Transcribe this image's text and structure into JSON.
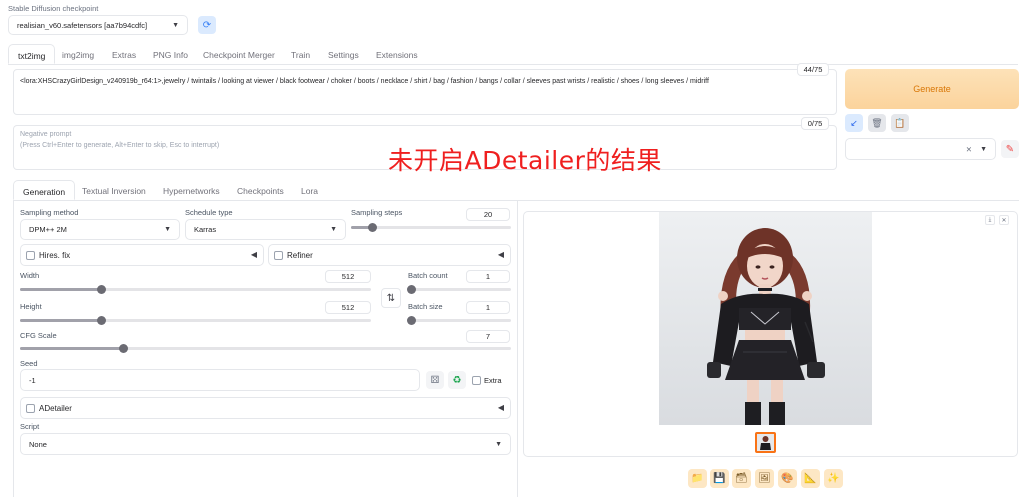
{
  "checkpoint": {
    "label": "Stable Diffusion checkpoint",
    "value": "realisian_v60.safetensors [aa7b94cdfc]"
  },
  "main_tabs": [
    "txt2img",
    "img2img",
    "Extras",
    "PNG Info",
    "Checkpoint Merger",
    "Train",
    "Settings",
    "Extensions"
  ],
  "prompt": {
    "value": "<lora:XHSCrazyGirlDesign_v240919b_r64:1>,jewelry / twintails / looking at viewer / black footwear / choker / boots / necklace / shirt / bag / fashion / bangs / collar / sleeves past wrists / realistic / shoes / long sleeves / midriff",
    "token_count": "44/75"
  },
  "negative_prompt": {
    "placeholder_line1": "Negative prompt",
    "placeholder_line2": "(Press Ctrl+Enter to generate, Alt+Enter to skip, Esc to interrupt)",
    "token_count": "0/75"
  },
  "generate_label": "Generate",
  "overlay_text": "未开启ADetailer的结果",
  "sub_tabs": [
    "Generation",
    "Textual Inversion",
    "Hypernetworks",
    "Checkpoints",
    "Lora"
  ],
  "generation": {
    "sampling_method_label": "Sampling method",
    "sampling_method_value": "DPM++ 2M",
    "schedule_type_label": "Schedule type",
    "schedule_type_value": "Karras",
    "sampling_steps_label": "Sampling steps",
    "sampling_steps_value": "20",
    "hires_label": "Hires. fix",
    "refiner_label": "Refiner",
    "width_label": "Width",
    "width_value": "512",
    "height_label": "Height",
    "height_value": "512",
    "batch_count_label": "Batch count",
    "batch_count_value": "1",
    "batch_size_label": "Batch size",
    "batch_size_value": "1",
    "cfg_label": "CFG Scale",
    "cfg_value": "7",
    "seed_label": "Seed",
    "seed_value": "-1",
    "extra_label": "Extra",
    "adetailer_label": "ADetailer",
    "script_label": "Script",
    "script_value": "None"
  },
  "slider_levels": {
    "sampling_steps": 0.13,
    "width": 0.23,
    "height": 0.23,
    "batch_count": 0.0,
    "batch_size": 0.0,
    "cfg": 0.21
  },
  "icons": {
    "refresh": "refresh-icon",
    "swap": "swap-icon",
    "dice": "dice-icon",
    "recycle": "recycle-icon",
    "pencil": "pencil-icon",
    "download": "download-icon",
    "close": "close-icon"
  },
  "colors": {
    "accent_orange": "#f97316",
    "generate_bg": "#fcdcad",
    "generate_text": "#d97706",
    "overlay_red": "#ef1f1f",
    "tool_bg": "#fde7c4"
  }
}
